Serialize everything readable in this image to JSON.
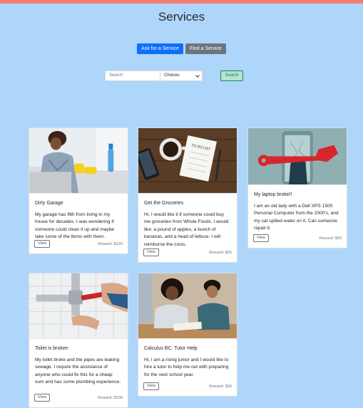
{
  "page": {
    "title": "Services"
  },
  "actions": {
    "ask_label": "Ask for a Service",
    "find_label": "Find a Service"
  },
  "search": {
    "placeholder": "Search",
    "select_value": "Choices",
    "button_label": "Search"
  },
  "view_label": "View",
  "cards": [
    {
      "title": "Dirty Garage",
      "text": "My garage has filth from living in my house for decades. I was wondering if someone could clean it up and maybe take some of the items with them.",
      "reward": "Reward: $120"
    },
    {
      "title": "Get the Groceries",
      "text": "Hi, I would like it if someone could buy me groceries from Whole Foods. I would like: a pound of apples, a bunch of bananas, and a head of lettuce. I will reimburse the costs.",
      "reward": "Reward: $25",
      "note_text": "TO DO LIST"
    },
    {
      "title": "My laptop broke!!",
      "text": "I am an old lady with a Dell XPS 1500 Personal Computer from the 2000's, and my cat spilled water on it. Can someone repair it.",
      "reward": "Reward: $50"
    },
    {
      "title": "Toilet is broken",
      "text": "My toilet broke and the pipes are leaking sewage. I require the assistance of anyone who could fix this for a cheap sum and has some plumbing experience.",
      "reward": "Reward: $100"
    },
    {
      "title": "Calculus BC: Tutor Help",
      "text": "Hi, I am a rising junior and I would like to hire a tutor to help me out with preparing for the next school year.",
      "reward": "Reward: $30"
    }
  ]
}
